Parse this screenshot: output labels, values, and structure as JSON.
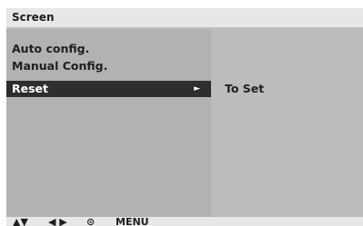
{
  "title": "Screen",
  "menu": {
    "items": [
      {
        "label": "Auto config."
      },
      {
        "label": "Manual Config."
      },
      {
        "label": "Reset",
        "selected": true,
        "arrow": "►"
      }
    ]
  },
  "submenu": {
    "value": "To Set"
  },
  "hints": {
    "up_down": "▲▼",
    "left_right": "◀ ▶",
    "ok": "⊙",
    "menu": "MENU"
  },
  "colors": {
    "selection_bg": "#2e2e2e",
    "panel_bg": "#b2b2b2",
    "bar_bg": "#e7e7e7"
  }
}
